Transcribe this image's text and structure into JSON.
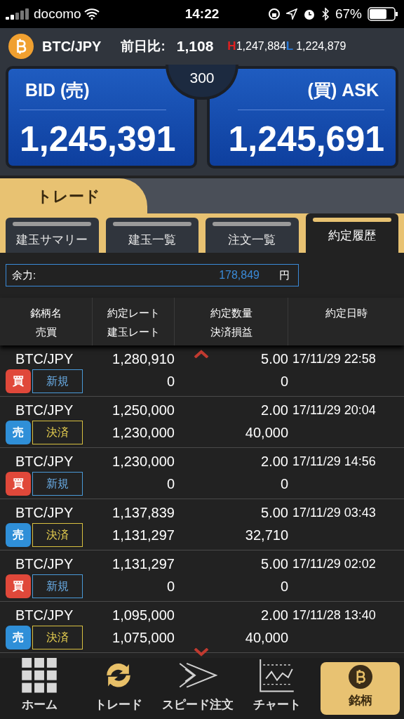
{
  "status_bar": {
    "carrier": "docomo",
    "time": "14:22",
    "battery": "67%"
  },
  "header": {
    "symbol": "BTC/JPY",
    "change_label": "前日比:",
    "change": "1,108",
    "high_label": "H",
    "high": "1,247,884",
    "low_label": "L",
    "low": "1,224,879"
  },
  "quote": {
    "bid_label": "BID (売)",
    "bid": "1,245,391",
    "spread": "300",
    "ask_label": "(買) ASK",
    "ask": "1,245,691"
  },
  "section_tab": "トレード",
  "tabs": [
    {
      "label": "建玉サマリー",
      "selected": false
    },
    {
      "label": "建玉一覧",
      "selected": false
    },
    {
      "label": "注文一覧",
      "selected": false
    },
    {
      "label": "約定履歴",
      "selected": true
    }
  ],
  "balance": {
    "label": "余力:",
    "value": "178,849",
    "unit": "円"
  },
  "columns": [
    [
      "銘柄名",
      "売買"
    ],
    [
      "約定レート",
      "建玉レート"
    ],
    [
      "約定数量",
      "決済損益"
    ],
    [
      "約定日時"
    ]
  ],
  "rows": [
    {
      "pair": "BTC/JPY",
      "side": {
        "label": "買",
        "kind": "buy"
      },
      "type": {
        "label": "新規",
        "kind": "new"
      },
      "rate": "1,280,910",
      "position_rate": "0",
      "qty": "5.00",
      "pnl": "0",
      "datetime": "17/11/29 22:58"
    },
    {
      "pair": "BTC/JPY",
      "side": {
        "label": "売",
        "kind": "sell"
      },
      "type": {
        "label": "決済",
        "kind": "close"
      },
      "rate": "1,250,000",
      "position_rate": "1,230,000",
      "qty": "2.00",
      "pnl": "40,000",
      "datetime": "17/11/29 20:04"
    },
    {
      "pair": "BTC/JPY",
      "side": {
        "label": "買",
        "kind": "buy"
      },
      "type": {
        "label": "新規",
        "kind": "new"
      },
      "rate": "1,230,000",
      "position_rate": "0",
      "qty": "2.00",
      "pnl": "0",
      "datetime": "17/11/29 14:56"
    },
    {
      "pair": "BTC/JPY",
      "side": {
        "label": "売",
        "kind": "sell"
      },
      "type": {
        "label": "決済",
        "kind": "close"
      },
      "rate": "1,137,839",
      "position_rate": "1,131,297",
      "qty": "5.00",
      "pnl": "32,710",
      "datetime": "17/11/29 03:43"
    },
    {
      "pair": "BTC/JPY",
      "side": {
        "label": "買",
        "kind": "buy"
      },
      "type": {
        "label": "新規",
        "kind": "new"
      },
      "rate": "1,131,297",
      "position_rate": "0",
      "qty": "5.00",
      "pnl": "0",
      "datetime": "17/11/29 02:02"
    },
    {
      "pair": "BTC/JPY",
      "side": {
        "label": "売",
        "kind": "sell"
      },
      "type": {
        "label": "決済",
        "kind": "close"
      },
      "rate": "1,095,000",
      "position_rate": "1,075,000",
      "qty": "2.00",
      "pnl": "40,000",
      "datetime": "17/11/28 13:40"
    }
  ],
  "nav": [
    {
      "label": "ホーム",
      "kind": "home",
      "selected": false
    },
    {
      "label": "トレード",
      "kind": "trade",
      "selected": false
    },
    {
      "label": "スピード注文",
      "kind": "speed",
      "selected": false
    },
    {
      "label": "チャート",
      "kind": "chart",
      "selected": false
    },
    {
      "label": "銘柄",
      "kind": "symbol",
      "selected": true
    }
  ]
}
